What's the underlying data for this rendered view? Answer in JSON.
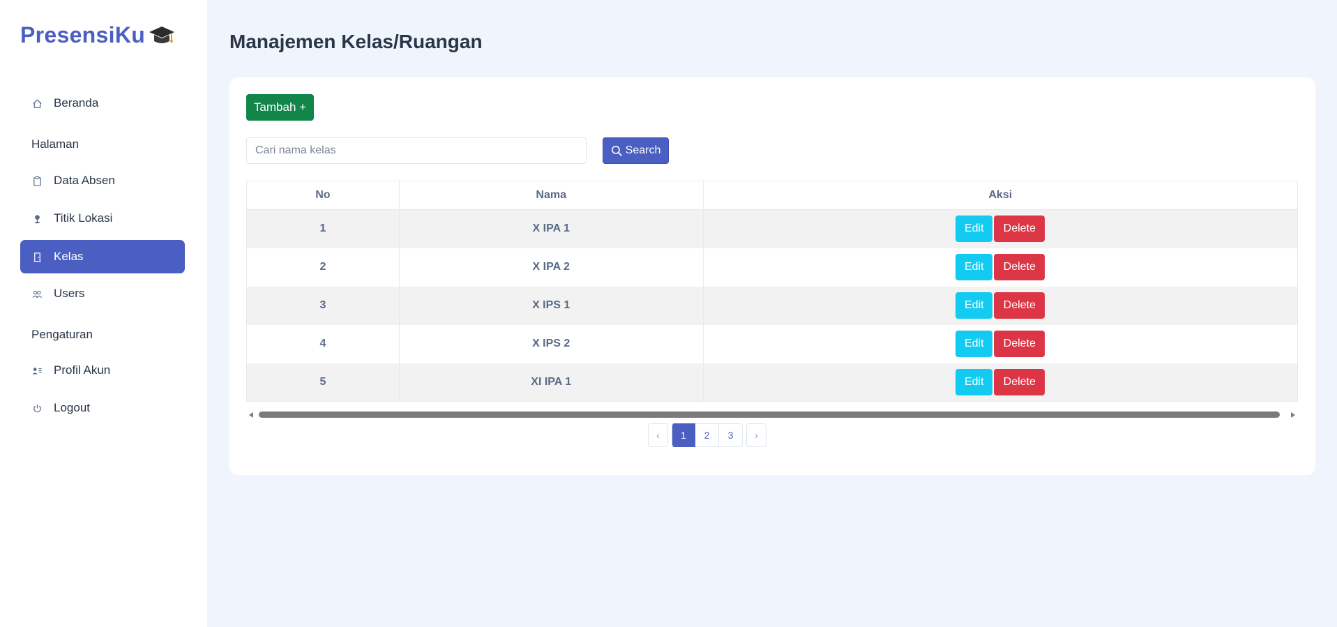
{
  "brand": {
    "name": "PresensiKu",
    "icon": "graduation-cap-icon"
  },
  "sidebar": {
    "items": [
      {
        "label": "Beranda",
        "icon": "home-icon",
        "active": false
      },
      {
        "section": "Halaman"
      },
      {
        "label": "Data Absen",
        "icon": "clipboard-icon",
        "active": false
      },
      {
        "label": "Titik Lokasi",
        "icon": "map-pin-icon",
        "active": false
      },
      {
        "label": "Kelas",
        "icon": "door-icon",
        "active": true
      },
      {
        "label": "Users",
        "icon": "users-icon",
        "active": false
      },
      {
        "section": "Pengaturan"
      },
      {
        "label": "Profil Akun",
        "icon": "user-card-icon",
        "active": false
      },
      {
        "label": "Logout",
        "icon": "power-icon",
        "active": false
      }
    ]
  },
  "page": {
    "title": "Manajemen Kelas/Ruangan"
  },
  "toolbar": {
    "add_label": "Tambah +",
    "search_placeholder": "Cari nama kelas",
    "search_value": "",
    "search_label": "Search"
  },
  "table": {
    "headers": [
      "No",
      "Nama",
      "Aksi"
    ],
    "rows": [
      {
        "no": "1",
        "nama": "X IPA 1"
      },
      {
        "no": "2",
        "nama": "X IPA 2"
      },
      {
        "no": "3",
        "nama": "X IPS 1"
      },
      {
        "no": "4",
        "nama": "X IPS 2"
      },
      {
        "no": "5",
        "nama": "XI IPA 1"
      }
    ],
    "edit_label": "Edit",
    "delete_label": "Delete"
  },
  "pagination": {
    "prev": "‹",
    "next": "›",
    "pages": [
      "1",
      "2",
      "3"
    ],
    "current": "1"
  },
  "colors": {
    "primary": "#4a5fc1",
    "success": "#13854a",
    "info": "#13caf0",
    "danger": "#dc3545",
    "background": "#f0f5fd"
  }
}
